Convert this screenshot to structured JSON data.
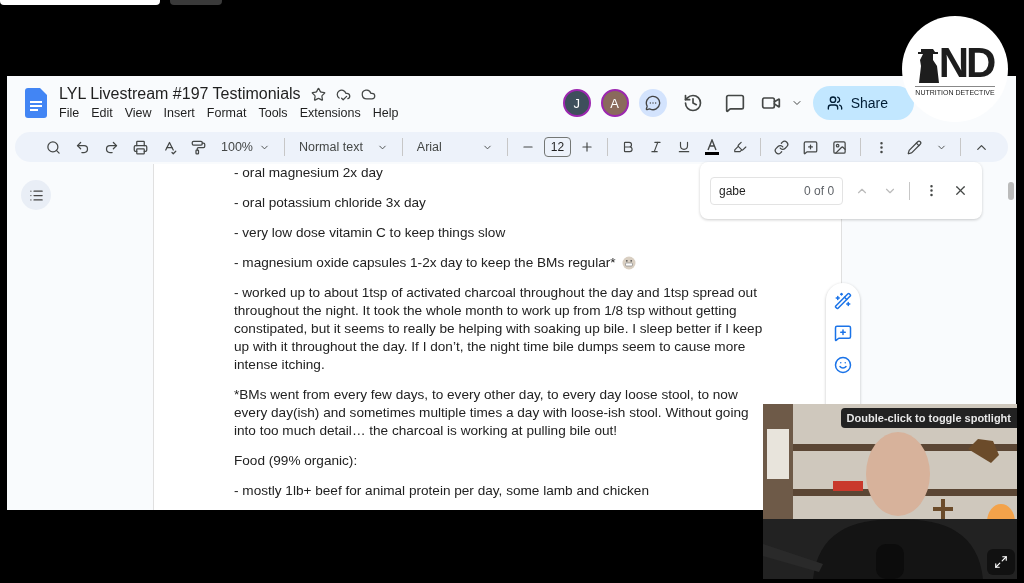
{
  "window": {
    "title": "LYL Livestream #197 Testimonials"
  },
  "menu": [
    "File",
    "Edit",
    "View",
    "Insert",
    "Format",
    "Tools",
    "Extensions",
    "Help"
  ],
  "collaborators": [
    {
      "initial": "J",
      "color": "#3e4f5c"
    },
    {
      "initial": "A",
      "color": "#8a6a5c"
    }
  ],
  "share_button": "Share",
  "toolbar": {
    "zoom": "100%",
    "style": "Normal text",
    "font": "Arial",
    "font_size": "12"
  },
  "find": {
    "value": "gabe",
    "count": "0 of 0"
  },
  "document": {
    "paragraphs": [
      {
        "kind": "plain",
        "text": "- oral magnesium 2x day"
      },
      {
        "kind": "plain",
        "text": "- oral potassium chloride 3x day"
      },
      {
        "kind": "plain",
        "text": "- very low dose vitamin C to keep things slow"
      },
      {
        "kind": "emoji",
        "text": "- magnesium oxide capsules 1-2x day to keep the BMs regular*"
      },
      {
        "kind": "plain",
        "text": "- worked up to about 1tsp of activated charcoal throughout the day and 1tsp spread out throughout the night. It took the whole month to work up from 1/8 tsp without getting constipated, but it seems to really be helping with soaking up bile. I sleep better if I keep up with it throughout the day. If I don’t, the night time bile dumps seem to cause more intense itching."
      },
      {
        "kind": "plain",
        "text": "*BMs went from every few days, to every other day, to every day loose stool, to now every day(ish) and sometimes multiple times a day with loose-ish stool. Without going into too much detail… the charcoal is working at pulling bile out!"
      },
      {
        "kind": "plain",
        "text": "Food (99% organic):"
      },
      {
        "kind": "plain",
        "text": "- mostly 1lb+ beef for animal protein per day, some lamb and chicken"
      }
    ]
  },
  "logo": {
    "mark": "ND",
    "caption": "NUTRITION DETECTIVE"
  },
  "webcam": {
    "kind": "picture",
    "tooltip": "Double-click to toggle spotlight"
  }
}
